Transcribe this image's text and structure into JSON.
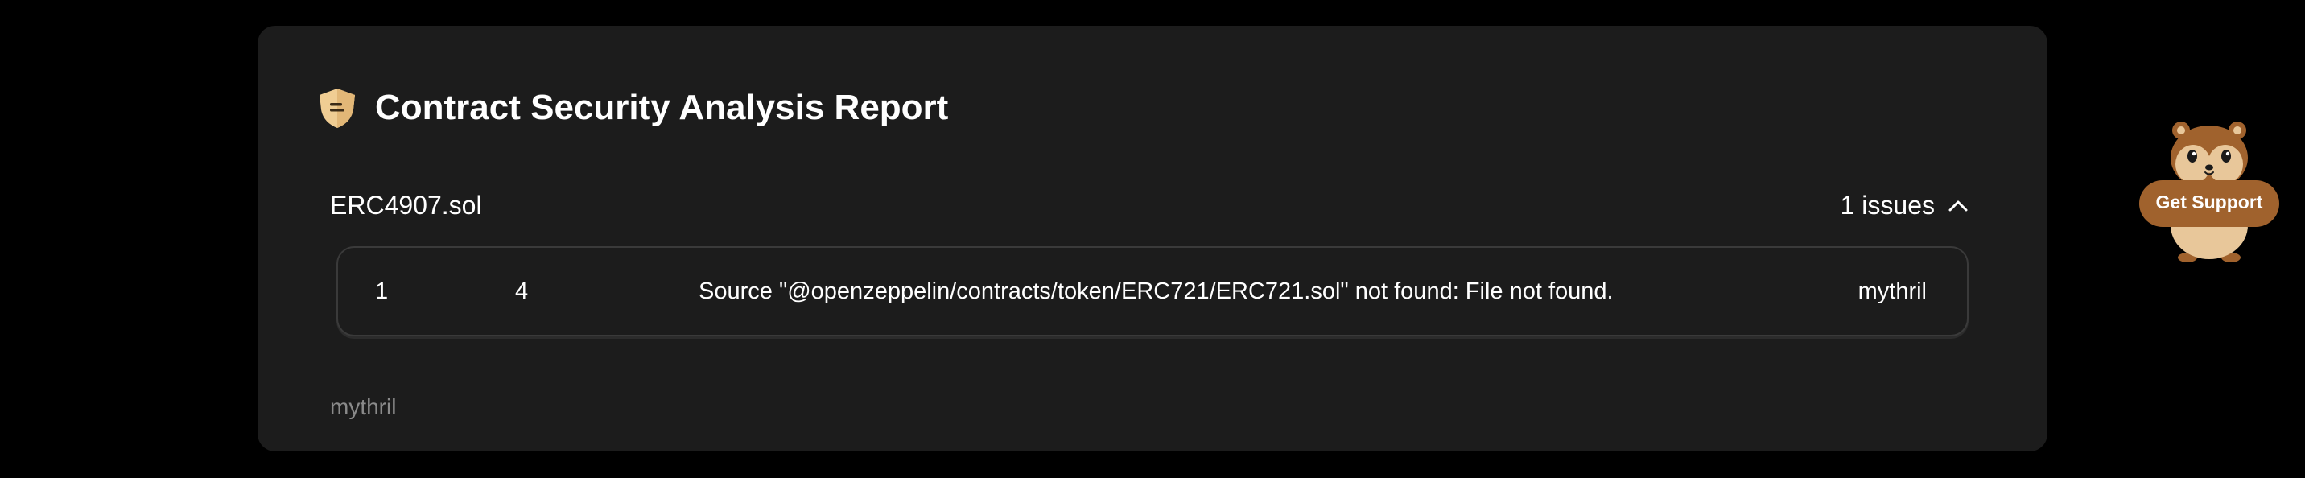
{
  "report": {
    "title": "Contract Security Analysis Report",
    "icon": "shield-icon",
    "file": {
      "name": "ERC4907.sol",
      "issues_label": "1 issues",
      "toggle_icon": "chevron-up-icon"
    },
    "issues": [
      {
        "id": "1",
        "line": "4",
        "description": "Source \"@openzeppelin/contracts/token/ERC721/ERC721.sol\" not found: File not found.",
        "tool": "mythril"
      }
    ],
    "footer_tool": "mythril"
  },
  "support": {
    "label": "Get Support",
    "icon": "hamster-mascot-icon"
  },
  "colors": {
    "page_background": "#000000",
    "card_background": "#1c1c1c",
    "border": "#3a3a3a",
    "muted_text": "#8a8a8a",
    "accent": "#a0622d",
    "shield": "#f0cd93"
  }
}
